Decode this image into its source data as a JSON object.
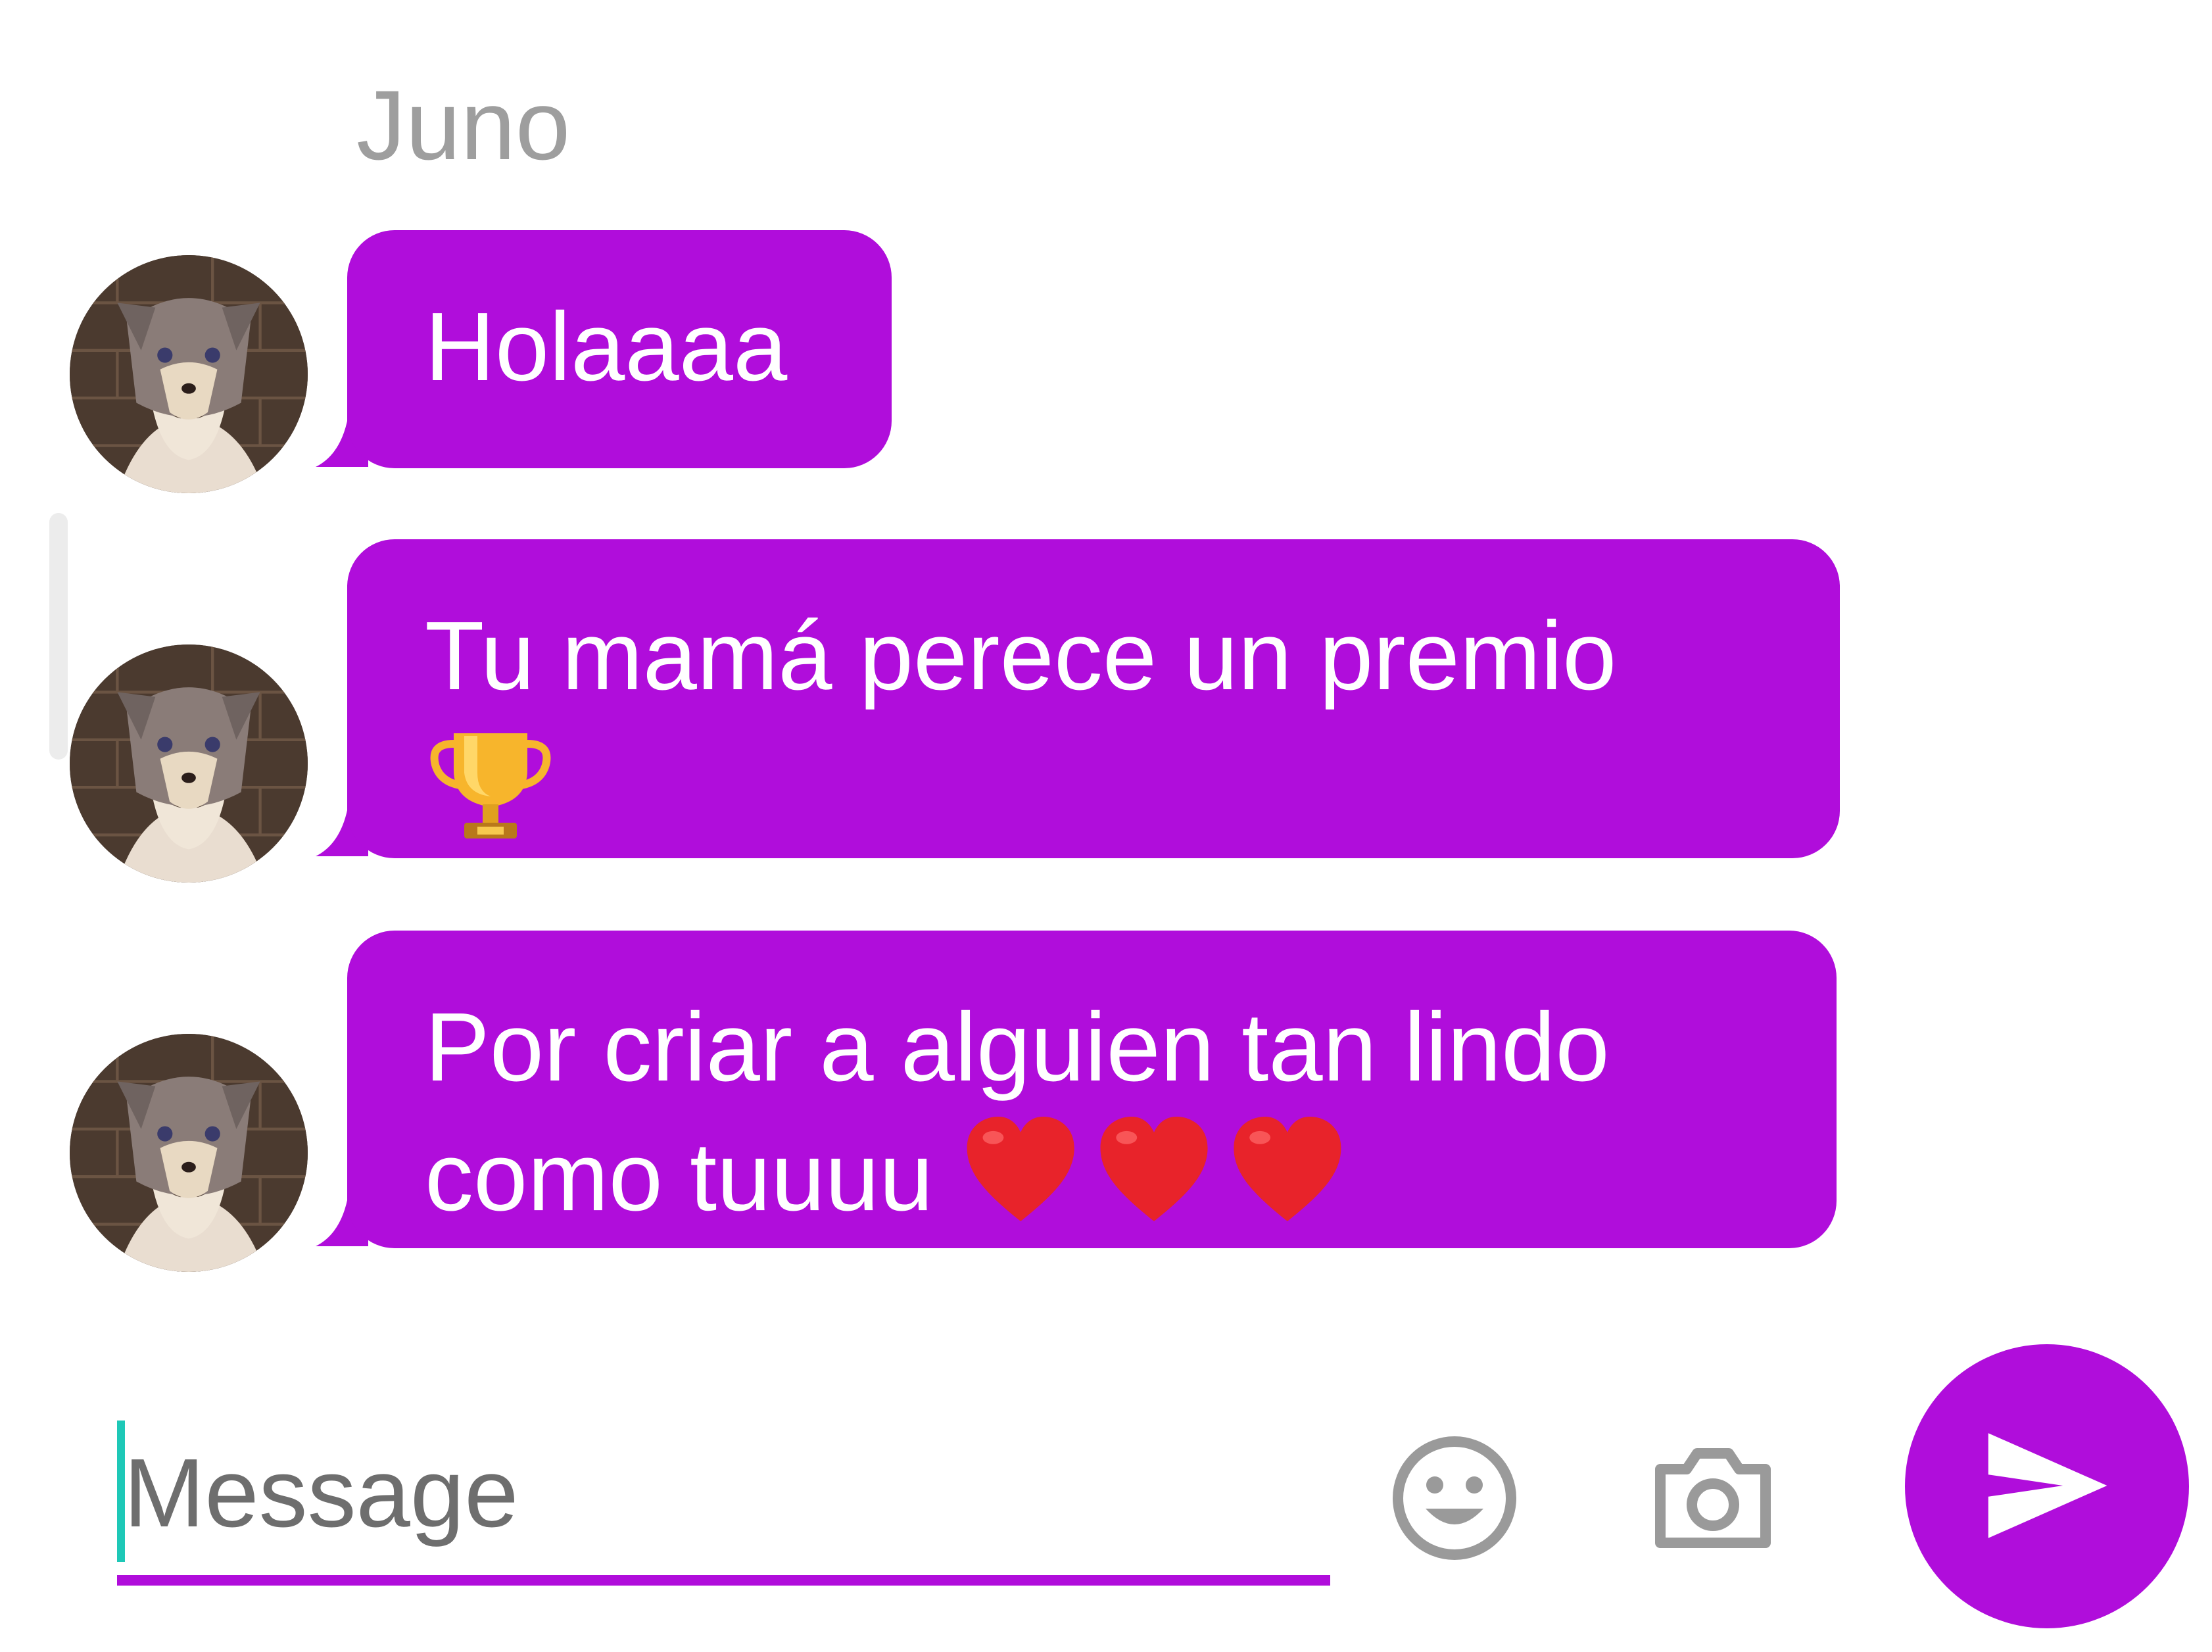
{
  "chat": {
    "sender_name": "Juno",
    "messages": [
      {
        "text": "Holaaaa",
        "emoji": ""
      },
      {
        "text": "Tu mamá perece un premio\n",
        "emoji": "trophy"
      },
      {
        "text": "Por criar a alguien tan lindo\ncomo tuuuu ",
        "emoji": "hearts"
      }
    ]
  },
  "composer": {
    "placeholder": "Message",
    "emoji_icon": "smiley-icon",
    "camera_icon": "camera-icon",
    "send_icon": "send-icon"
  },
  "colors": {
    "accent": "#b00ddb",
    "cursor": "#1ec8b7",
    "name_text": "#9e9e9e",
    "icon_gray": "#9a9a9a"
  }
}
